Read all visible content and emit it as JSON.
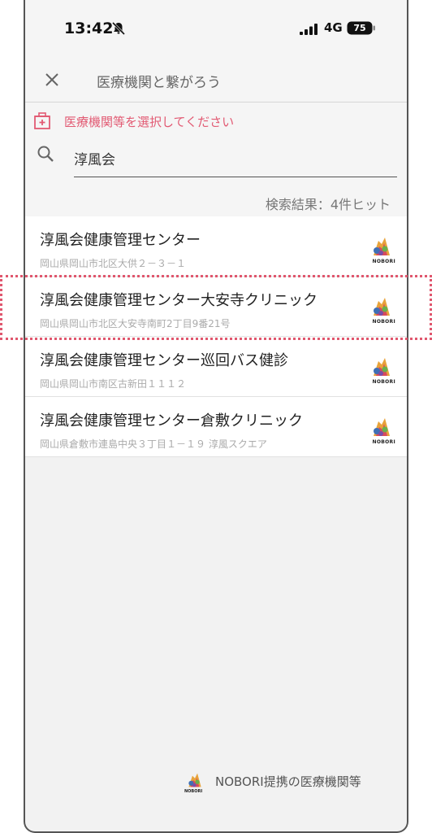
{
  "status_bar": {
    "time": "13:42",
    "network": "4G",
    "battery": "75"
  },
  "header": {
    "title": "医療機関と繋がろう"
  },
  "search": {
    "hint": "医療機関等を選択してください",
    "value": "淳風会",
    "result_count": "検索結果：4件ヒット"
  },
  "results": [
    {
      "name": "淳風会健康管理センター",
      "address": "岡山県岡山市北区大供２－３－１",
      "logo_text": "NOBORI"
    },
    {
      "name": "淳風会健康管理センター大安寺クリニック",
      "address": "岡山県岡山市北区大安寺南町2丁目9番21号",
      "logo_text": "NOBORI"
    },
    {
      "name": "淳風会健康管理センター巡回バス健診",
      "address": "岡山県岡山市南区古新田１１１２",
      "logo_text": "NOBORI"
    },
    {
      "name": "淳風会健康管理センター倉敷クリニック",
      "address": "岡山県倉敷市連島中央３丁目１－１９ 淳風スクエア",
      "logo_text": "NOBORI"
    }
  ],
  "footer": {
    "label": "NOBORI提携の医療機関等",
    "logo_text": "NOBORI"
  },
  "colors": {
    "accent": "#e25a73",
    "highlight": "#e0576e"
  }
}
